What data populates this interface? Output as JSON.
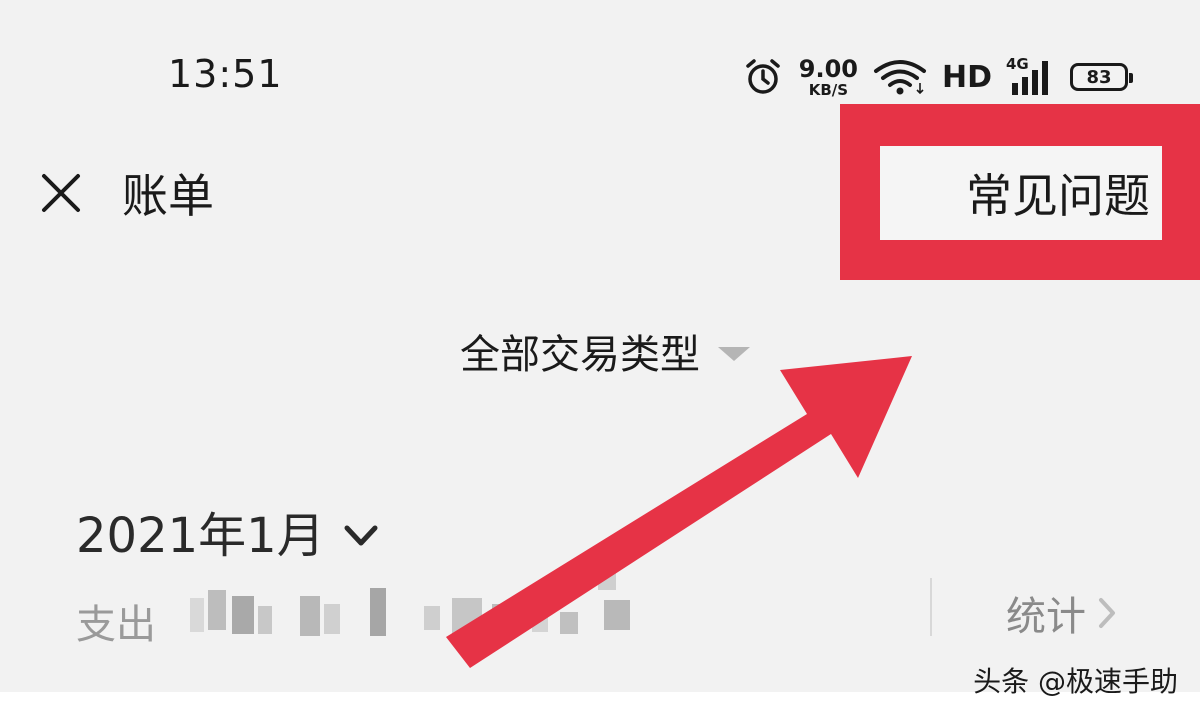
{
  "status_bar": {
    "time": "13:51",
    "net_speed_value": "9.00",
    "net_speed_unit": "KB/S",
    "hd_label": "HD",
    "network_type": "4G",
    "battery_level": "83",
    "icons": [
      "alarm-icon",
      "wifi-icon",
      "signal-icon",
      "battery-icon"
    ]
  },
  "header": {
    "title": "账单",
    "close_icon": "close-icon",
    "faq_label": "常见问题"
  },
  "filter": {
    "label": "全部交易类型",
    "icon": "triangle-down-icon"
  },
  "month": {
    "label": "2021年1月",
    "icon": "chevron-down-icon"
  },
  "summary": {
    "expense_label": "支出",
    "stats_label": "统计",
    "stats_icon": "chevron-right-icon"
  },
  "watermark": "头条 @极速手助",
  "colors": {
    "highlight": "#e63346",
    "background": "#f2f2f2",
    "muted_text": "#9a9a9a"
  }
}
